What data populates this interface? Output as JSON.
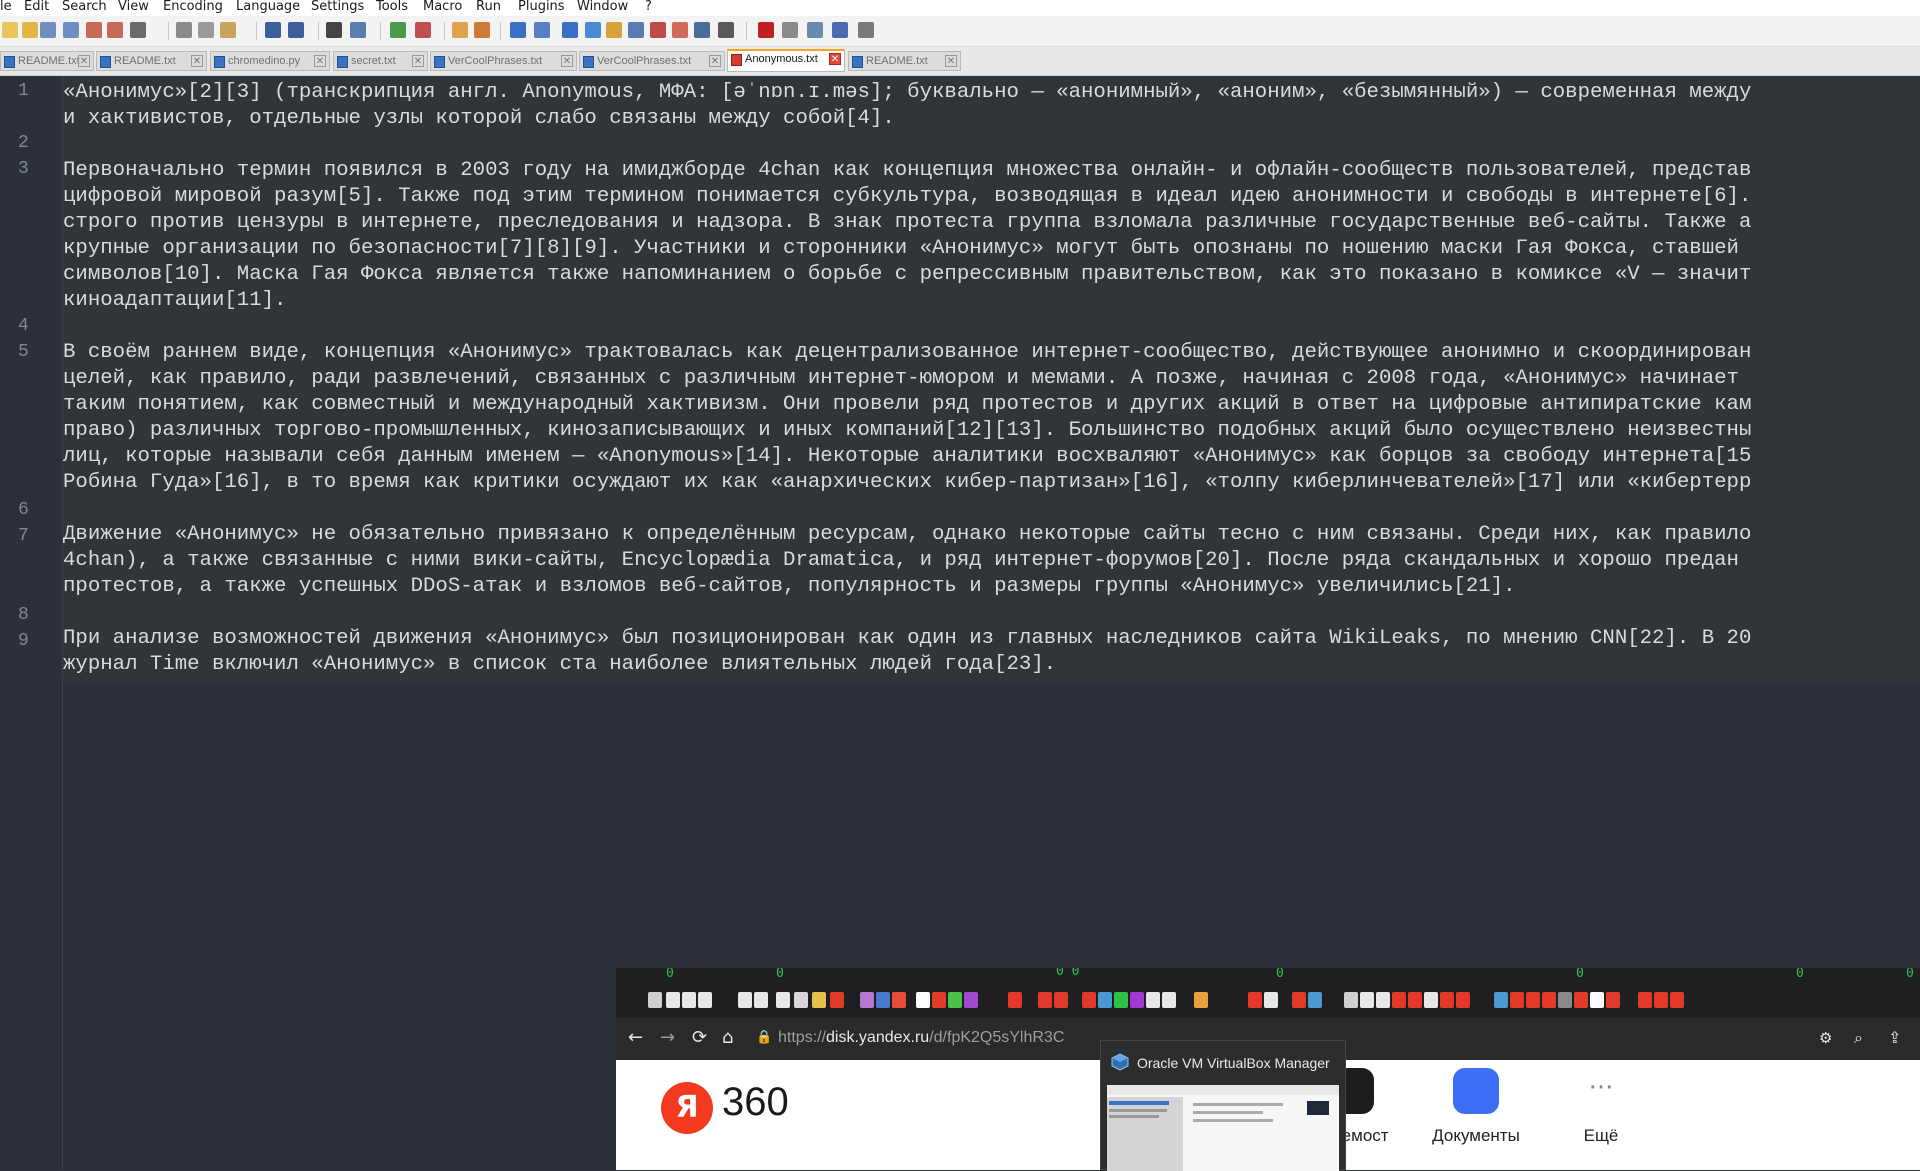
{
  "menu": [
    "le",
    "Edit",
    "Search",
    "View",
    "Encoding",
    "Language",
    "Settings",
    "Tools",
    "Macro",
    "Run",
    "Plugins",
    "Window",
    "?"
  ],
  "tabs": [
    {
      "label": "README.txt",
      "active": false
    },
    {
      "label": "README.txt",
      "active": false
    },
    {
      "label": "chromedino.py",
      "active": false
    },
    {
      "label": "secret.txt",
      "active": false
    },
    {
      "label": "VerCoolPhrases.txt",
      "active": false
    },
    {
      "label": "VerCoolPhrases.txt",
      "active": false
    },
    {
      "label": "Anonymous.txt",
      "active": true
    },
    {
      "label": "README.txt",
      "active": false
    }
  ],
  "line_numbers": [
    "1",
    "2",
    "3",
    "4",
    "5",
    "6",
    "7",
    "8",
    "9"
  ],
  "text_lines": [
    "«Анонимус»[2][3] (транскрипция англ. Anonymous, МФА: [əˈnɒn.ɪ.məs]; буквально — «анонимный», «аноним», «безымянный») — современная между",
    "и хактивистов, отдельные узлы которой слабо связаны между собой[4].",
    "",
    "Первоначально термин появился в 2003 году на имиджборде 4chan как концепция множества онлайн- и офлайн-сообществ пользователей, представ",
    "цифровой мировой разум[5]. Также под этим термином понимается субкультура, возводящая в идеал идею анонимности и свободы в интернете[6].",
    "строго против цензуры в интернете, преследования и надзора. В знак протеста группа взломала различные государственные веб-сайты. Также а",
    "крупные организации по безопасности[7][8][9]. Участники и сторонники «Анонимус» могут быть опознаны по ношению маски Гая Фокса, ставшей",
    "символов[10]. Маска Гая Фокса является также напоминанием о борьбе с репрессивным правительством, как это показано в комиксе «V — значит",
    "киноадаптации[11].",
    "",
    "В своём раннем виде, концепция «Анонимус» трактовалась как децентрализованное интернет-сообщество, действующее анонимно и скоординирован",
    "целей, как правило, ради развлечений, связанных с различным интернет-юмором и мемами. А позже, начиная с 2008 года, «Анонимус» начинает",
    "таким понятием, как совместный и международный хактивизм. Они провели ряд протестов и других акций в ответ на цифровые антипиратские кам",
    "право) различных торгово-промышленных, кинозаписывающих и иных компаний[12][13]. Большинство подобных акций было осуществлено неизвестны",
    "лиц, которые называли себя данным именем — «Anonymous»[14]. Некоторые аналитики восхваляют «Анонимус» как борцов за свободу интернета[15",
    "Робина Гуда»[16], в то время как критики осуждают их как «анархических кибер-партизан»[16], «толпу киберлинчевателей»[17] или «кибертерр",
    "",
    "Движение «Анонимус» не обязательно привязано к определённым ресурсам, однако некоторые сайты тесно с ним связаны. Среди них, как правило",
    "4chan), а также связанные с ними вики-сайты, Encyclopædia Dramatica, и ряд интернет-форумов[20]. После ряда скандальных и хорошо предан",
    "протестов, а также успешных DDoS-атак и взломов веб-сайтов, популярность и размеры группы «Анонимус» увеличились[21].",
    "",
    "При анализе возможностей движения «Анонимус» был позиционирован как один из главных наследников сайта WikiLeaks, по мнению CNN[22]. В 20",
    "журнал Time включил «Анонимус» в список ста наиболее влиятельных людей года[23]."
  ],
  "browser": {
    "url_scheme": "https://",
    "url_domain": "disk.yandex.ru",
    "url_path": "/d/fpK2Q5sYlhR3C",
    "logo_letter": "Я",
    "logo_text": "360",
    "apps": [
      {
        "label": "Телемост",
        "color": "#1d1d1d"
      },
      {
        "label": "Документы",
        "color": "#3d6ef5"
      },
      {
        "label": "Ещё",
        "color": "#ffffff"
      }
    ]
  },
  "thumbnail": {
    "title": "Oracle VM VirtualBox Manager"
  },
  "colors": {
    "editor_bg": "#2b3136",
    "text": "#d8dbdd",
    "active_tab_accent": "#f5a623",
    "yandex_red": "#f33a1f"
  }
}
